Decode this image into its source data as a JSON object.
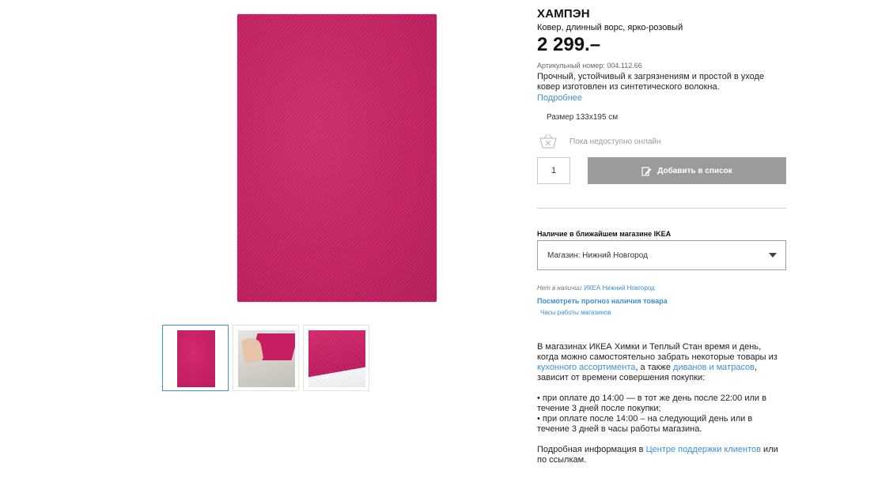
{
  "product": {
    "name": "ХАМПЭН",
    "description": "Ковер, длинный ворс, ярко-розовый",
    "price": "2 299.–",
    "article": "Артикульный номер: 004.112.66",
    "text": "Прочный, устойчивый к загрязнениям и простой в уходе ковер изготовлен из синтетического волокна.",
    "more_link": "Подробнее",
    "size": "Размер 133x195 см"
  },
  "purchase": {
    "unavailable": "Пока недоступно онлайн",
    "quantity": "1",
    "add_to_list": "Добавить в список"
  },
  "availability": {
    "title": "Наличие в ближайшем магазине IKEA",
    "store_select": "Магазин: Нижний Новгород",
    "not_in_stock": "Нет в наличии",
    "store_name": "ИКЕА Нижний Новгород",
    "forecast_link": "Посмотреть прогноз наличия товара",
    "hours_link": "Часы работы магазинов"
  },
  "info": {
    "p1_a": "В магазинах ИКЕА Химки и Теплый Стан время и день, когда можно самостоятельно забрать некоторые товары из ",
    "p1_link1": "кухонного ассортимента",
    "p1_b": ", а также ",
    "p1_link2": "диванов и матрасов",
    "p1_c": ", зависит от времени совершения покупки:",
    "bullet1": "• при оплате до 14:00 — в тот же день после 22:00 или в течение 3 дней после покупки;",
    "bullet2": "• при оплате после 14:00 – на следующий день или в течение 3 дней в часы работы магазина.",
    "p3_a": "Подробная информация в ",
    "p3_link": "Центре поддержки клиентов",
    "p3_b": " или по ссылкам."
  },
  "colors": {
    "accent": "#3b8fd6",
    "rug": "#c81d62",
    "button": "#9b9b9b"
  }
}
